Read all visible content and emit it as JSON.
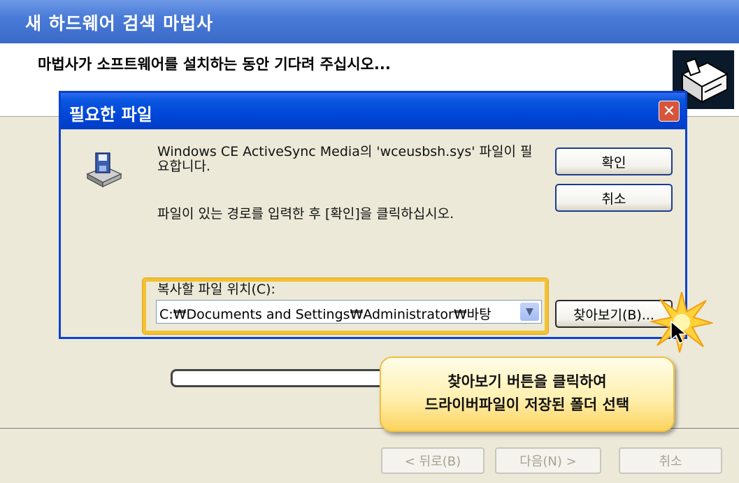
{
  "wizard": {
    "title": "새 하드웨어 검색 마법사",
    "subtitle": "마법사가 소프트웨어를 설치하는 동안 기다려 주십시오...",
    "back_label": "< 뒤로(B)",
    "next_label": "다음(N) >",
    "cancel_label": "취소"
  },
  "dialog": {
    "title": "필요한 파일",
    "close_glyph": "✕",
    "message": "Windows CE ActiveSync Media의 'wceusbsh.sys' 파일이 필요합니다.",
    "instruction": "파일이 있는 경로를 입력한 후 [확인]을 클릭하십시오.",
    "ok_label": "확인",
    "cancel_label": "취소",
    "location_label": "복사할 파일 위치(C):",
    "location_value": "C:₩Documents and Settings₩Administrator₩바탕",
    "combo_arrow": "▼",
    "browse_label": "찾아보기(B)..."
  },
  "callout": {
    "line1": "찾아보기 버튼을 클릭하여",
    "line2": "드라이버파일이 저장된 폴더 선택"
  },
  "colors": {
    "title_blue": "#0047d8",
    "highlight_yellow": "#f2c234",
    "close_red": "#d8543a"
  }
}
